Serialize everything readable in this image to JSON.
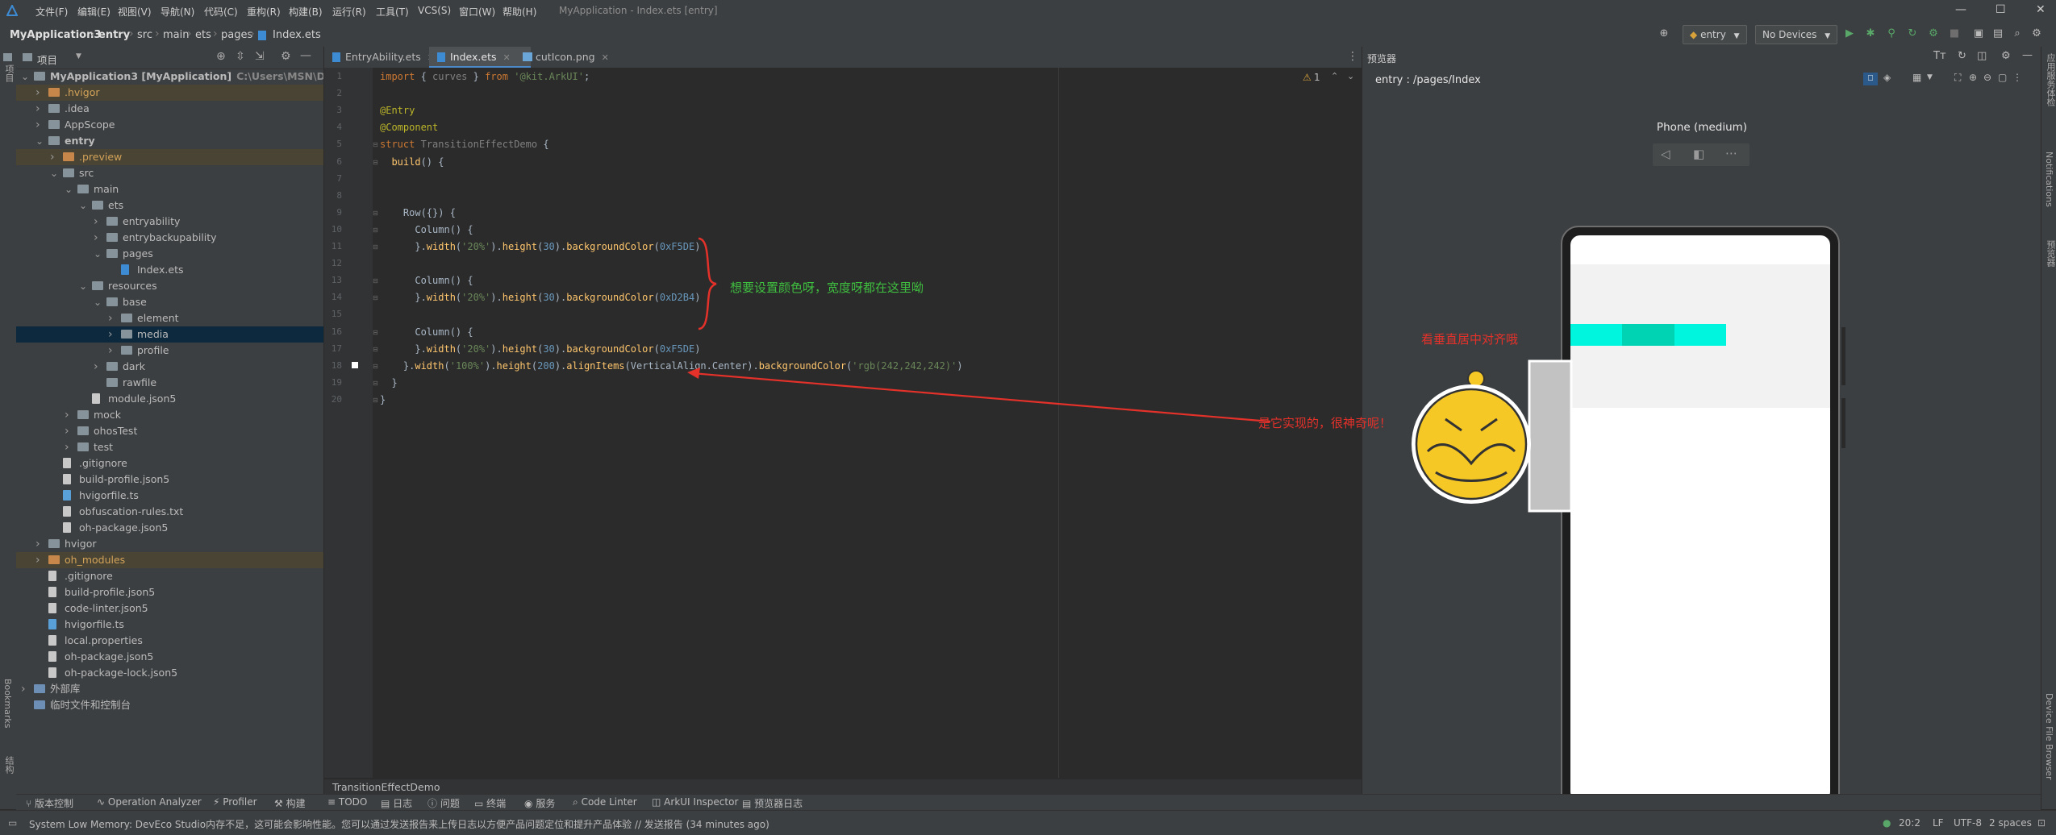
{
  "app": {
    "menus": [
      "文件(F)",
      "编辑(E)",
      "视图(V)",
      "导航(N)",
      "代码(C)",
      "重构(R)",
      "构建(B)",
      "运行(R)",
      "工具(T)",
      "VCS(S)",
      "窗口(W)",
      "帮助(H)"
    ],
    "window_title": "MyApplication - Index.ets [entry]"
  },
  "nav": {
    "crumbs": [
      "MyApplication3",
      "entry",
      "src",
      "main",
      "ets",
      "pages",
      "Index.ets"
    ],
    "module_select": "entry",
    "device_select": "No Devices"
  },
  "left_stripe": {
    "project": "项目",
    "bookmarks": "Bookmarks",
    "structure": "结构"
  },
  "project_panel": {
    "title": "项目",
    "rows": [
      {
        "label": "MyApplication3 [MyApplication]",
        "hint": "C:\\Users\\MSN\\DevEco",
        "indent": 0,
        "chev": "v",
        "icon": "folder",
        "bold": true
      },
      {
        "label": ".hvigor",
        "indent": 1,
        "chev": ">",
        "icon": "folder-orange",
        "state": "excluded"
      },
      {
        "label": ".idea",
        "indent": 1,
        "chev": ">",
        "icon": "folder"
      },
      {
        "label": "AppScope",
        "indent": 1,
        "chev": ">",
        "icon": "folder"
      },
      {
        "label": "entry",
        "indent": 1,
        "chev": "v",
        "icon": "folder",
        "bold": true
      },
      {
        "label": ".preview",
        "indent": 2,
        "chev": ">",
        "icon": "folder-orange",
        "state": "excluded"
      },
      {
        "label": "src",
        "indent": 2,
        "chev": "v",
        "icon": "folder"
      },
      {
        "label": "main",
        "indent": 3,
        "chev": "v",
        "icon": "folder"
      },
      {
        "label": "ets",
        "indent": 4,
        "chev": "v",
        "icon": "folder"
      },
      {
        "label": "entryability",
        "indent": 5,
        "chev": ">",
        "icon": "folder"
      },
      {
        "label": "entrybackupability",
        "indent": 5,
        "chev": ">",
        "icon": "folder"
      },
      {
        "label": "pages",
        "indent": 5,
        "chev": "v",
        "icon": "folder"
      },
      {
        "label": "Index.ets",
        "indent": 6,
        "chev": "",
        "icon": "file-ets"
      },
      {
        "label": "resources",
        "indent": 4,
        "chev": "v",
        "icon": "folder"
      },
      {
        "label": "base",
        "indent": 5,
        "chev": "v",
        "icon": "folder"
      },
      {
        "label": "element",
        "indent": 6,
        "chev": ">",
        "icon": "folder"
      },
      {
        "label": "media",
        "indent": 6,
        "chev": ">",
        "icon": "folder",
        "state": "selected"
      },
      {
        "label": "profile",
        "indent": 6,
        "chev": ">",
        "icon": "folder"
      },
      {
        "label": "dark",
        "indent": 5,
        "chev": ">",
        "icon": "folder"
      },
      {
        "label": "rawfile",
        "indent": 5,
        "chev": "",
        "icon": "folder"
      },
      {
        "label": "module.json5",
        "indent": 4,
        "chev": "",
        "icon": "file"
      },
      {
        "label": "mock",
        "indent": 3,
        "chev": ">",
        "icon": "folder"
      },
      {
        "label": "ohosTest",
        "indent": 3,
        "chev": ">",
        "icon": "folder"
      },
      {
        "label": "test",
        "indent": 3,
        "chev": ">",
        "icon": "folder"
      },
      {
        "label": ".gitignore",
        "indent": 2,
        "chev": "",
        "icon": "file"
      },
      {
        "label": "build-profile.json5",
        "indent": 2,
        "chev": "",
        "icon": "file"
      },
      {
        "label": "hvigorfile.ts",
        "indent": 2,
        "chev": "",
        "icon": "file-ts"
      },
      {
        "label": "obfuscation-rules.txt",
        "indent": 2,
        "chev": "",
        "icon": "file"
      },
      {
        "label": "oh-package.json5",
        "indent": 2,
        "chev": "",
        "icon": "file"
      },
      {
        "label": "hvigor",
        "indent": 1,
        "chev": ">",
        "icon": "folder"
      },
      {
        "label": "oh_modules",
        "indent": 1,
        "chev": ">",
        "icon": "folder-orange",
        "state": "excluded"
      },
      {
        "label": ".gitignore",
        "indent": 1,
        "chev": "",
        "icon": "file"
      },
      {
        "label": "build-profile.json5",
        "indent": 1,
        "chev": "",
        "icon": "file"
      },
      {
        "label": "code-linter.json5",
        "indent": 1,
        "chev": "",
        "icon": "file"
      },
      {
        "label": "hvigorfile.ts",
        "indent": 1,
        "chev": "",
        "icon": "file-ts"
      },
      {
        "label": "local.properties",
        "indent": 1,
        "chev": "",
        "icon": "file"
      },
      {
        "label": "oh-package.json5",
        "indent": 1,
        "chev": "",
        "icon": "file"
      },
      {
        "label": "oh-package-lock.json5",
        "indent": 1,
        "chev": "",
        "icon": "file"
      },
      {
        "label": "外部库",
        "indent": 0,
        "chev": ">",
        "icon": "library"
      },
      {
        "label": "临时文件和控制台",
        "indent": 0,
        "chev": "",
        "icon": "scratch"
      }
    ]
  },
  "editor": {
    "tabs": [
      {
        "label": "EntryAbility.ets",
        "active": false
      },
      {
        "label": "Index.ets",
        "active": true
      },
      {
        "label": "cutIcon.png",
        "active": false
      }
    ],
    "warning_count": "1",
    "lines": [
      "import { curves } from '@kit.ArkUI';",
      "",
      "@Entry",
      "@Component",
      "struct TransitionEffectDemo {",
      "  build() {",
      "",
      "",
      "    Row({}) {",
      "      Column() {",
      "      }.width('20%').height(30).backgroundColor(0xF5DE)",
      "",
      "      Column() {",
      "      }.width('20%').height(30).backgroundColor(0xD2B4)",
      "",
      "      Column() {",
      "      }.width('20%').height(30).backgroundColor(0xF5DE)",
      "    }.width('100%').height(200).alignItems(VerticalAlign.Center).backgroundColor('rgb(242,242,242)')",
      "  }",
      "}"
    ],
    "annotation_green": "想要设置颜色呀，宽度呀都在这里呦",
    "bottom_breadcrumb": "TransitionEffectDemo"
  },
  "preview": {
    "panel_title": "预览器",
    "route": "entry : /pages/Index",
    "device_name": "Phone (medium)",
    "row_bg": "#f2f2f2",
    "col_colors": [
      "#00f5de",
      "#00d2b4",
      "#00f5de"
    ],
    "col_width_fraction": 0.2
  },
  "annotations": {
    "note_vertical": "看垂直居中对齐哦",
    "note_realized": "是它实现的，很神奇呢！"
  },
  "right_stripe": [
    "应用服务体检",
    "Notifications",
    "预览器",
    "Device File Browser"
  ],
  "toolwindows": [
    "版本控制",
    "Operation Analyzer",
    "Profiler",
    "构建",
    "TODO",
    "日志",
    "问题",
    "终端",
    "服务",
    "Code Linter",
    "ArkUI Inspector",
    "预览器日志"
  ],
  "status": {
    "message": "System Low Memory: DevEco Studio内存不足，这可能会影响性能。您可以通过发送报告来上传日志以方便产品问题定位和提升产品体验 // 发送报告 (34 minutes ago)",
    "position": "20:2",
    "line_sep": "LF",
    "encoding": "UTF-8",
    "indent": "2 spaces"
  }
}
